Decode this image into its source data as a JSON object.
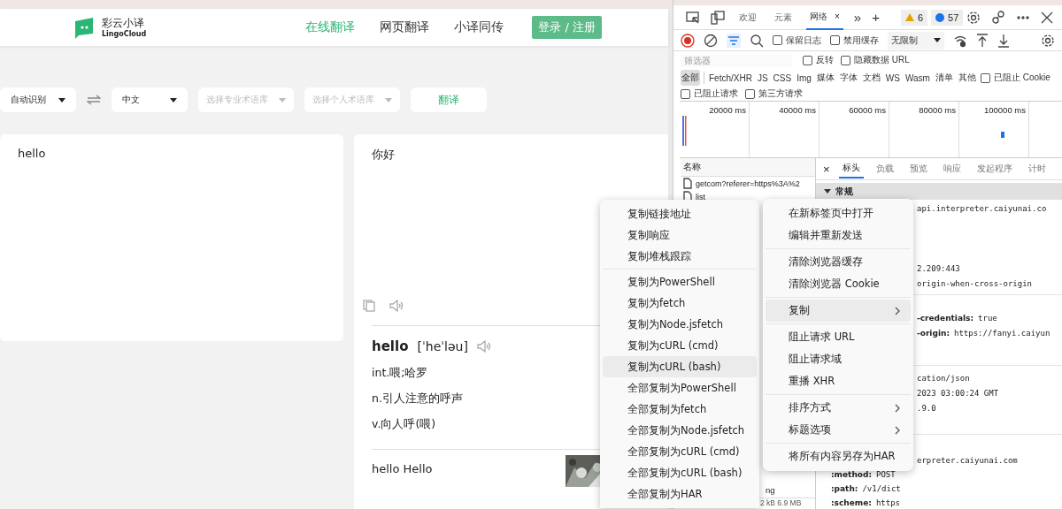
{
  "site": {
    "logo": {
      "name": "彩云小译",
      "sub": "LingoCloud"
    },
    "nav": [
      {
        "label": "在线翻译",
        "selected": true
      },
      {
        "label": "网页翻译",
        "selected": false
      },
      {
        "label": "小译同传",
        "selected": false
      }
    ],
    "login": "登录 / 注册",
    "controls": [
      {
        "kind": "select",
        "label": "自动识别",
        "disabled": false
      },
      {
        "kind": "swap"
      },
      {
        "kind": "select",
        "label": "中文",
        "disabled": false
      },
      {
        "kind": "select",
        "label": "选择专业术语库",
        "disabled": true
      },
      {
        "kind": "select",
        "label": "选择个人术语库",
        "disabled": true
      },
      {
        "kind": "button",
        "label": "翻译"
      }
    ],
    "source_text": "hello",
    "target_text": "你好",
    "dict": {
      "word": "hello",
      "phonetic": "[ˈheˈləu]",
      "senses": [
        "int.喂;哈罗",
        "n.引人注意的呼声",
        "v.向人呼(喂)"
      ]
    },
    "example": {
      "title": "hello Hello",
      "kind": "picture"
    }
  },
  "devtools": {
    "tabs": [
      {
        "kind": "inspect"
      },
      {
        "kind": "device"
      },
      {
        "kind": "tab",
        "label": "欢迎",
        "selected": false
      },
      {
        "kind": "tab",
        "label": "元素",
        "selected": false
      },
      {
        "kind": "tab",
        "label": "网络",
        "selected": true,
        "close": "×"
      },
      {
        "kind": "text",
        "label": "»"
      },
      {
        "kind": "text",
        "label": "+"
      }
    ],
    "warnings": "6",
    "messages": "57",
    "toolbar": {
      "preserve_log": {
        "label": "保留日志",
        "checked": false
      },
      "disable_cache": {
        "label": "禁用缓存",
        "checked": false
      },
      "throttle": "无限制"
    },
    "filter": {
      "placeholder": "筛选器",
      "invert": {
        "label": "反转",
        "checked": false
      },
      "hide_data": {
        "label": "隐藏数据 URL",
        "checked": false
      }
    },
    "types": [
      {
        "label": "全部",
        "selected": true
      },
      {
        "label": "Fetch/XHR",
        "selected": false
      },
      {
        "label": "JS",
        "selected": false
      },
      {
        "label": "CSS",
        "selected": false
      },
      {
        "label": "Img",
        "selected": false
      },
      {
        "label": "媒体",
        "selected": false
      },
      {
        "label": "字体",
        "selected": false
      },
      {
        "label": "文档",
        "selected": false
      },
      {
        "label": "WS",
        "selected": false
      },
      {
        "label": "Wasm",
        "selected": false
      },
      {
        "label": "清单",
        "selected": false
      },
      {
        "label": "其他",
        "selected": false
      }
    ],
    "blocked_cookies": {
      "label": "已阻止 Cookie",
      "checked": false
    },
    "blocked_requests": {
      "label": "已阻止请求",
      "checked": false
    },
    "third_party": {
      "label": "第三方请求",
      "checked": false
    },
    "timeline_ticks": [
      "20000 ms",
      "40000 ms",
      "60000 ms",
      "80000 ms",
      "100000 ms"
    ],
    "list": {
      "header": "名称",
      "rows": [
        "getcom?referer=https%3A%2",
        "list"
      ],
      "bottom_row": "ng",
      "status": "2 kB 6.9 MB"
    },
    "detail_tabs": [
      {
        "label": "标头",
        "selected": true
      },
      {
        "label": "负载",
        "selected": false
      },
      {
        "label": "预览",
        "selected": false
      },
      {
        "label": "响应",
        "selected": false
      },
      {
        "label": "发起程序",
        "selected": false
      },
      {
        "label": "计时",
        "selected": false
      }
    ],
    "detail_close": "×",
    "section": "常规",
    "detail_groups": [
      [
        {
          "kind": "covered",
          "value": "api.interpreter.caiyunai.co"
        },
        {
          "kind": "covered",
          "value": "2.209:443"
        },
        {
          "kind": "covered",
          "value": "origin-when-cross-origin"
        }
      ],
      [
        {
          "kind": "covered",
          "name": "-credentials:",
          "value": "true"
        },
        {
          "kind": "covered",
          "name": "-origin:",
          "value": "https://fanyi.caiyun"
        }
      ],
      [
        {
          "kind": "covered",
          "value": "cation/json"
        },
        {
          "kind": "covered",
          "value": "2023 03:00:24 GMT"
        },
        {
          "kind": "covered",
          "value": ".9.0"
        }
      ],
      [
        {
          "kind": "covered",
          "value": "erpreter.caiyunai.com"
        },
        {
          "kind": "full",
          "name": ":method:",
          "value": "POST"
        },
        {
          "kind": "full",
          "name": ":path:",
          "value": "/v1/dict"
        },
        {
          "kind": "full",
          "name": ":scheme:",
          "value": "https"
        }
      ]
    ]
  },
  "copy_menu": [
    [
      {
        "label": "复制链接地址",
        "selected": false
      },
      {
        "label": "复制响应",
        "selected": false
      },
      {
        "label": "复制堆栈跟踪",
        "selected": false
      }
    ],
    [
      {
        "label": "复制为PowerShell",
        "selected": false
      },
      {
        "label": "复制为fetch",
        "selected": false
      },
      {
        "label": "复制为Node.jsfetch",
        "selected": false
      },
      {
        "label": "复制为cURL (cmd)",
        "selected": false
      },
      {
        "label": "复制为cURL (bash)",
        "selected": true
      },
      {
        "label": "全部复制为PowerShell",
        "selected": false
      },
      {
        "label": "全部复制为fetch",
        "selected": false
      },
      {
        "label": "全部复制为Node.jsfetch",
        "selected": false
      },
      {
        "label": "全部复制为cURL (cmd)",
        "selected": false
      },
      {
        "label": "全部复制为cURL (bash)",
        "selected": false
      },
      {
        "label": "全部复制为HAR",
        "selected": false
      }
    ]
  ],
  "context_menu": [
    [
      {
        "label": "在新标签页中打开",
        "selected": false,
        "submenu": false
      },
      {
        "label": "编辑并重新发送",
        "selected": false,
        "submenu": false
      }
    ],
    [
      {
        "label": "清除浏览器缓存",
        "selected": false,
        "submenu": false
      },
      {
        "label": "清除浏览器 Cookie",
        "selected": false,
        "submenu": false
      }
    ],
    [
      {
        "label": "复制",
        "selected": true,
        "submenu": true
      }
    ],
    [
      {
        "label": "阻止请求 URL",
        "selected": false,
        "submenu": false
      },
      {
        "label": "阻止请求域",
        "selected": false,
        "submenu": false
      },
      {
        "label": "重播 XHR",
        "selected": false,
        "submenu": false
      }
    ],
    [
      {
        "label": "排序方式",
        "selected": false,
        "submenu": true
      },
      {
        "label": "标题选项",
        "selected": false,
        "submenu": true
      }
    ],
    [
      {
        "label": "将所有内容另存为HAR",
        "selected": false,
        "submenu": false
      }
    ]
  ]
}
